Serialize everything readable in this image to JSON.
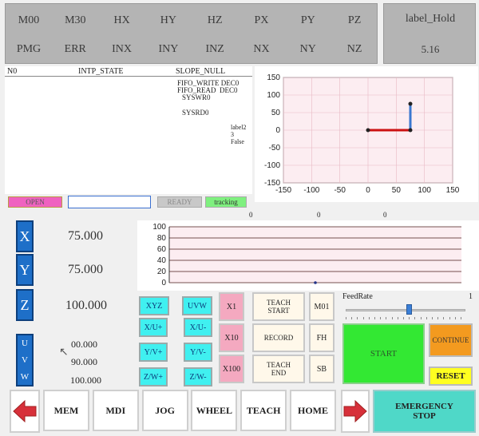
{
  "status_grid": {
    "row1": [
      "M00",
      "M30",
      "HX",
      "HY",
      "HZ",
      "PX",
      "PY",
      "PZ"
    ],
    "row2": [
      "PMG",
      "ERR",
      "INX",
      "INY",
      "INZ",
      "NX",
      "NY",
      "NZ"
    ]
  },
  "hold": {
    "label": "label_Hold",
    "value": "5.16"
  },
  "info": {
    "no": "N0",
    "intp_state": "INTP_STATE",
    "slope": "SLOPE_NULL",
    "fifo_write": "FIFO_WRITE DEC0",
    "fifo_read": "FIFO_READ  DEC0",
    "syswr": "SYSWR0",
    "sysrd": "SYSRD0",
    "label2": "label2",
    "three": "3",
    "false_text": "False"
  },
  "status_bar": {
    "open": "OPEN",
    "input_value": "",
    "ready": "READY",
    "tracking": "tracking"
  },
  "readouts": {
    "r1": "0",
    "r2": "0",
    "r3": "0"
  },
  "axes": {
    "x": {
      "label": "X",
      "value": "75.000"
    },
    "y": {
      "label": "Y",
      "value": "75.000"
    },
    "z": {
      "label": "Z",
      "value": "100.000"
    },
    "uvw_label": [
      "U",
      "V",
      "W"
    ],
    "uvw_values": [
      "00.000",
      "90.000",
      "100.000"
    ]
  },
  "jog": {
    "xyz": "XYZ",
    "uvw": "UVW",
    "xu_plus": "X/U+",
    "xu_minus": "X/U-",
    "yv_plus": "Y/V+",
    "yv_minus": "Y/V-",
    "zw_plus": "Z/W+",
    "zw_minus": "Z/W-"
  },
  "multipliers": [
    "X1",
    "X10",
    "X100"
  ],
  "teach": {
    "start_l1": "TEACH",
    "start_l2": "START",
    "record": "RECORD",
    "end_l1": "TEACH",
    "end_l2": "END"
  },
  "mcodes": [
    "M01",
    "FH",
    "SB"
  ],
  "feedrate": {
    "label": "FeedRate",
    "value": "1",
    "level_fraction": 0.53
  },
  "actions": {
    "start": "START",
    "continue": "CONTINUE",
    "reset": "RESET",
    "emergency_l1": "EMERGENCY",
    "emergency_l2": "STOP"
  },
  "modes": [
    "MEM",
    "MDI",
    "JOG",
    "WHEEL",
    "TEACH",
    "HOME"
  ],
  "colors": {
    "axis_blue": "#1e6fc8",
    "start_green": "#33e833",
    "continue_orange": "#f39a1f",
    "reset_yellow": "#ffff20",
    "estop_teal": "#4fd8c8",
    "arrow_red": "#d7303a",
    "open_pink": "#ef62c0",
    "tracking_green": "#7ff07f"
  },
  "chart_data": [
    {
      "type": "line",
      "title": "",
      "xlabel": "",
      "ylabel": "",
      "xlim": [
        -150,
        150
      ],
      "ylim": [
        -150,
        150
      ],
      "xticks": [
        -150,
        -100,
        -50,
        0,
        50,
        100,
        150
      ],
      "yticks": [
        -150,
        -100,
        -50,
        0,
        50,
        100,
        150
      ],
      "grid": true,
      "series": [
        {
          "color": "#cc1111",
          "x": [
            0,
            75
          ],
          "y": [
            0,
            0
          ]
        },
        {
          "color": "#3a78d0",
          "x": [
            75,
            75
          ],
          "y": [
            0,
            75
          ]
        }
      ],
      "points": [
        [
          0,
          0
        ],
        [
          75,
          75
        ],
        [
          75,
          0
        ]
      ]
    },
    {
      "type": "scatter",
      "title": "",
      "xlabel": "",
      "ylabel": "",
      "ylim": [
        0,
        100
      ],
      "yticks": [
        0,
        20,
        40,
        60,
        80,
        100
      ],
      "grid": true,
      "points": [
        [
          0.5,
          0
        ]
      ]
    }
  ]
}
